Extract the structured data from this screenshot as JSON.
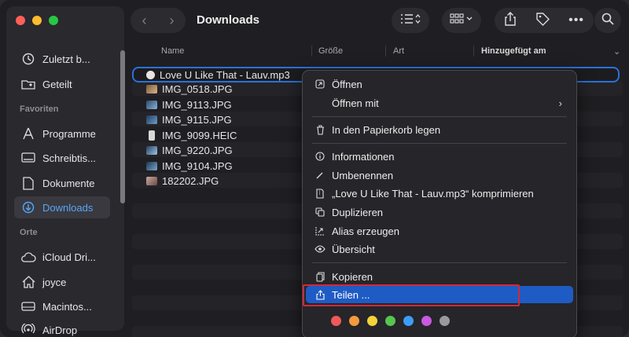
{
  "sidebar": {
    "items_top": [
      {
        "label": "Zuletzt b...",
        "icon": "clock-icon"
      },
      {
        "label": "Geteilt",
        "icon": "shared-folder-icon"
      }
    ],
    "favorites_title": "Favoriten",
    "favorites": [
      {
        "label": "Programme",
        "icon": "apps-icon"
      },
      {
        "label": "Schreibtis...",
        "icon": "desktop-icon"
      },
      {
        "label": "Dokumente",
        "icon": "document-icon"
      },
      {
        "label": "Downloads",
        "icon": "download-icon",
        "selected": true
      }
    ],
    "locations_title": "Orte",
    "locations": [
      {
        "label": "iCloud Dri...",
        "icon": "cloud-icon"
      },
      {
        "label": "joyce",
        "icon": "home-icon"
      },
      {
        "label": "Macintos...",
        "icon": "drive-icon"
      },
      {
        "label": "AirDrop",
        "icon": "airdrop-icon"
      }
    ]
  },
  "toolbar": {
    "title": "Downloads"
  },
  "columns": {
    "name": "Name",
    "size": "Größe",
    "kind": "Art",
    "added": "Hinzugefügt am"
  },
  "files": [
    {
      "name": "Love U Like That - Lauv.mp3",
      "selected": true
    },
    {
      "name": "IMG_0518.JPG"
    },
    {
      "name": "IMG_9113.JPG"
    },
    {
      "name": "IMG_9115.JPG"
    },
    {
      "name": "IMG_9099.HEIC"
    },
    {
      "name": "IMG_9220.JPG"
    },
    {
      "name": "IMG_9104.JPG"
    },
    {
      "name": "182202.JPG"
    }
  ],
  "menu": {
    "open": "Öffnen",
    "open_with": "Öffnen mit",
    "trash": "In den Papierkorb legen",
    "info": "Informationen",
    "rename": "Umbenennen",
    "compress": "„Love U Like That - Lauv.mp3“ komprimieren",
    "duplicate": "Duplizieren",
    "alias": "Alias erzeugen",
    "quicklook": "Übersicht",
    "copy": "Kopieren",
    "share": "Teilen ...",
    "tag_colors": [
      "#ee5a5a",
      "#f39a3e",
      "#f3d33a",
      "#57c54e",
      "#3d9df5",
      "#c85ae0",
      "#9a9a9e"
    ]
  }
}
